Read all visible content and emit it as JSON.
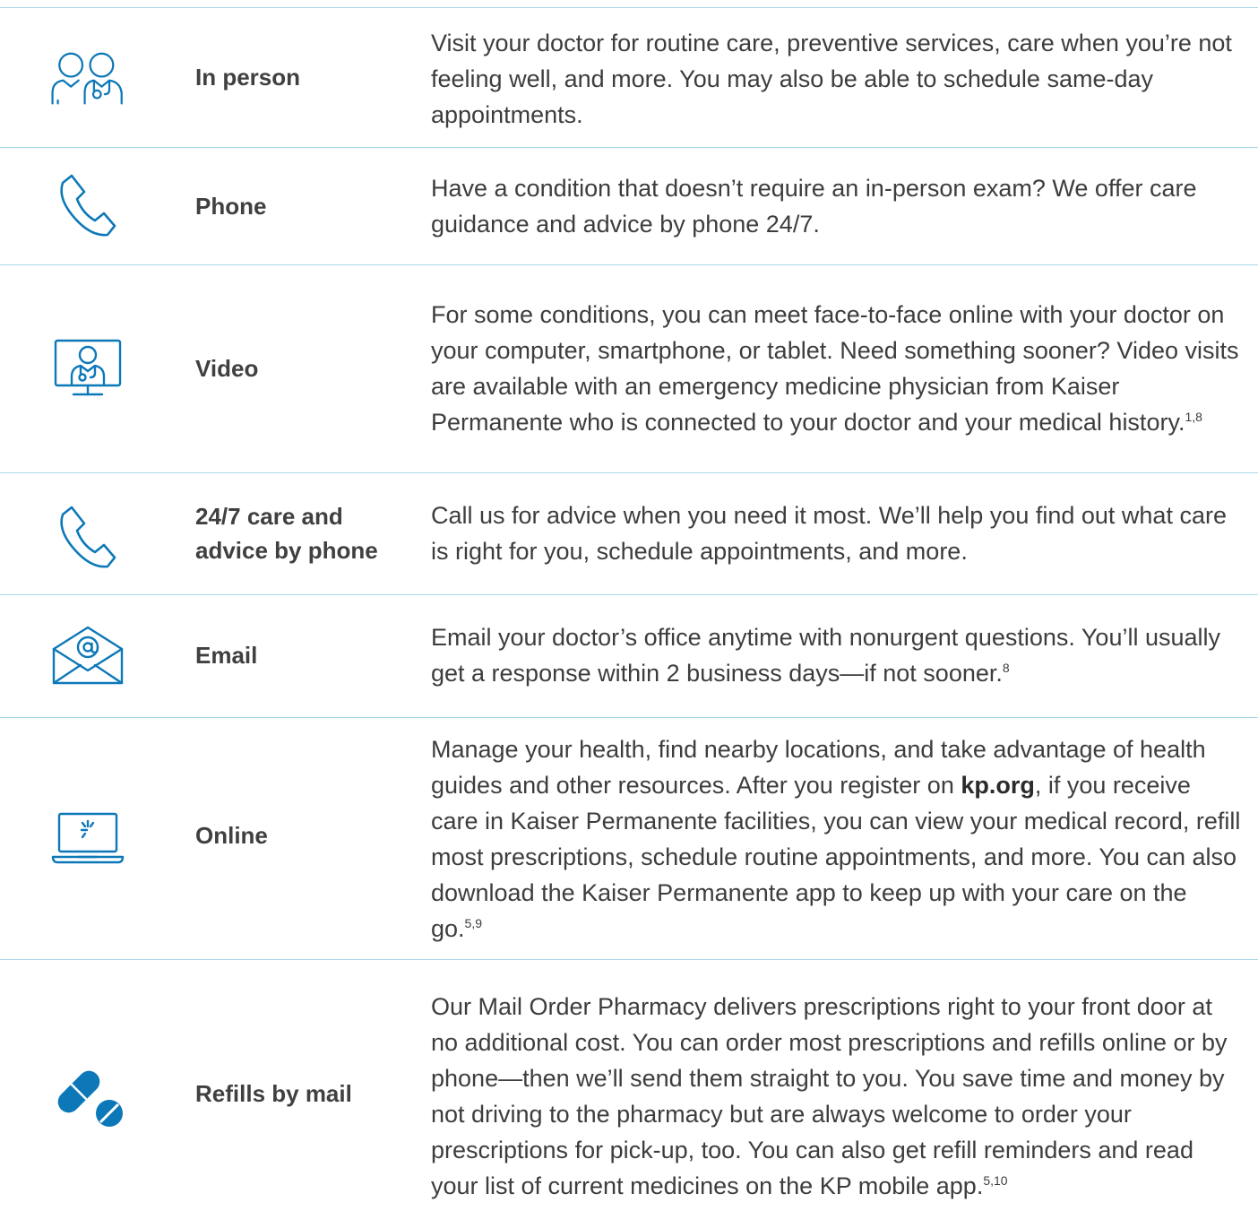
{
  "colors": {
    "icon_blue": "#0d78b8",
    "divider": "#a8d8e8",
    "text": "#3d3d3d"
  },
  "rows": [
    {
      "icon": "doctor-and-patient-icon",
      "label": "In person",
      "description": "Visit your doctor for routine care, preventive services, care when you’re not feeling well, and more. You may also be able to schedule same-day appointments."
    },
    {
      "icon": "phone-icon",
      "label": "Phone",
      "description": "Have a condition that doesn’t require an in-person exam? We offer care guidance and advice by phone 24/7."
    },
    {
      "icon": "video-doctor-monitor-icon",
      "label": "Video",
      "description": "For some conditions, you can meet face-to-face online with your doctor on your computer, smartphone, or tablet. Need something sooner? Video visits are available with an emergency medicine physician from Kaiser Permanente who is connected to your doctor and your medical history.",
      "footnote": "1,8"
    },
    {
      "icon": "phone-icon",
      "label": "24/7 care and advice by phone",
      "description": "Call us for advice when you need it most. We’ll help you find out what care is right for you, schedule appointments, and more."
    },
    {
      "icon": "email-envelope-icon",
      "label": "Email",
      "description": "Email your doctor’s office anytime with nonurgent questions. You’ll usually get a response within 2 business days—if not sooner.",
      "footnote": "8"
    },
    {
      "icon": "laptop-icon",
      "label": "Online",
      "description_before_link": "Manage your health, find nearby locations, and take advantage of health guides and other resources. After you register on ",
      "link": "kp.org",
      "description_after_link": ", if you receive care in Kaiser Permanente facilities, you can view your medical record, refill most prescriptions, schedule routine appointments, and more. You can also download the Kaiser Permanente app to keep up with your care on the go.",
      "footnote": "5,9"
    },
    {
      "icon": "pills-icon",
      "label": "Refills by mail",
      "description": "Our Mail Order Pharmacy delivers prescriptions right to your front door at no additional cost. You can order most prescriptions and refills online or by phone—then we’ll send them straight to you. You save time and money by not driving to the pharmacy but are always welcome to order your prescriptions for pick-up, too. You can also get refill reminders and read your list of current medicines on the KP mobile app.",
      "footnote": "5,10"
    }
  ]
}
